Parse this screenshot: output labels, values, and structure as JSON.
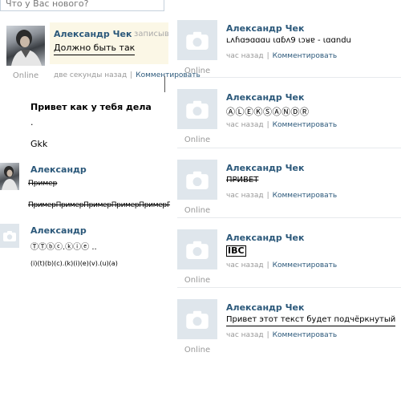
{
  "compose": {
    "placeholder": "Что у Вас нового?"
  },
  "colors": {
    "link": "#2B587A",
    "meta": "#999999",
    "avatar_bg": "#dfe6ec",
    "divider": "#e7eaed",
    "highlight_bg": "#fbf7e6"
  },
  "left_feed": {
    "top_post": {
      "author": "Александр Чек",
      "suffix": "записыв",
      "text": "Должно быть так",
      "online": "Online",
      "time": "две секунды назад",
      "comment_link": "Комментировать"
    },
    "message_block": {
      "heading": "Привет как у тебя дела",
      "dot": ".",
      "line": "Gkk"
    },
    "post2": {
      "author": "Александр",
      "text1": "Пример",
      "text2": "ПримерПримерПримерПримерПримерПример"
    },
    "post3": {
      "author": "Александр",
      "text1": "ⓉⓉⓑⓒ.ⓚⓘⓔ ..",
      "text2": "(i)(t)(b)(c).(k)(i)(e)(v).(u)(a)"
    }
  },
  "right_feed": [
    {
      "author": "Александр Чек",
      "text": "ʟʌɦɑɘɑɑɑu ɩɑɓʌ9 ɩɔᴚɐ - ɩɑɑndu",
      "online": "Online",
      "time": "час назад",
      "comment_link": "Комментировать"
    },
    {
      "author": "Александр Чек",
      "text": "ⒶⓁⒺⓀⓈⒶⓃⒹⓇ",
      "online": "Online",
      "time": "час назад",
      "comment_link": "Комментировать"
    },
    {
      "author": "Александр Чек",
      "text": "ПРИВЕТ",
      "online": "Online",
      "time": "час назад",
      "comment_link": "Комментировать"
    },
    {
      "author": "Александр Чек",
      "text": "IBC",
      "online": "Online",
      "time": "час назад",
      "comment_link": "Комментировать"
    },
    {
      "author": "Александр Чек",
      "text": "Привет этот текст будет подчёркнутый",
      "online": "Online",
      "time": "час назад",
      "comment_link": "Комментировать"
    }
  ]
}
